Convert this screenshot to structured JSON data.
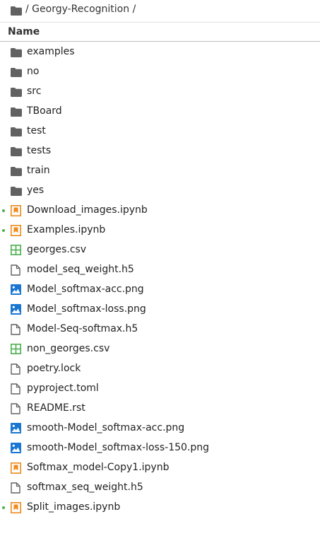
{
  "breadcrumb": {
    "path": "/ Georgy-Recognition /"
  },
  "header": {
    "name_label": "Name"
  },
  "colors": {
    "folder": "#616161",
    "notebook": "#ef8a1b",
    "spreadsheet": "#4caf50",
    "image": "#1976d2",
    "generic_file": "#616161",
    "running_dot": "#4caf50"
  },
  "files": [
    {
      "name": "examples",
      "icon": "folder-icon",
      "running": false
    },
    {
      "name": "no",
      "icon": "folder-icon",
      "running": false
    },
    {
      "name": "src",
      "icon": "folder-icon",
      "running": false
    },
    {
      "name": "TBoard",
      "icon": "folder-icon",
      "running": false
    },
    {
      "name": "test",
      "icon": "folder-icon",
      "running": false
    },
    {
      "name": "tests",
      "icon": "folder-icon",
      "running": false
    },
    {
      "name": "train",
      "icon": "folder-icon",
      "running": false
    },
    {
      "name": "yes",
      "icon": "folder-icon",
      "running": false
    },
    {
      "name": "Download_images.ipynb",
      "icon": "notebook-icon",
      "running": true
    },
    {
      "name": "Examples.ipynb",
      "icon": "notebook-icon",
      "running": true
    },
    {
      "name": "georges.csv",
      "icon": "spreadsheet-icon",
      "running": false
    },
    {
      "name": "model_seq_weight.h5",
      "icon": "file-icon",
      "running": false
    },
    {
      "name": "Model_softmax-acc.png",
      "icon": "image-icon",
      "running": false
    },
    {
      "name": "Model_softmax-loss.png",
      "icon": "image-icon",
      "running": false
    },
    {
      "name": "Model-Seq-softmax.h5",
      "icon": "file-icon",
      "running": false
    },
    {
      "name": "non_georges.csv",
      "icon": "spreadsheet-icon",
      "running": false
    },
    {
      "name": "poetry.lock",
      "icon": "file-icon",
      "running": false
    },
    {
      "name": "pyproject.toml",
      "icon": "file-icon",
      "running": false
    },
    {
      "name": "README.rst",
      "icon": "file-icon",
      "running": false
    },
    {
      "name": "smooth-Model_softmax-acc.png",
      "icon": "image-icon",
      "running": false
    },
    {
      "name": "smooth-Model_softmax-loss-150.png",
      "icon": "image-icon",
      "running": false
    },
    {
      "name": "Softmax_model-Copy1.ipynb",
      "icon": "notebook-icon",
      "running": false
    },
    {
      "name": "softmax_seq_weight.h5",
      "icon": "file-icon",
      "running": false
    },
    {
      "name": "Split_images.ipynb",
      "icon": "notebook-icon",
      "running": true
    }
  ]
}
